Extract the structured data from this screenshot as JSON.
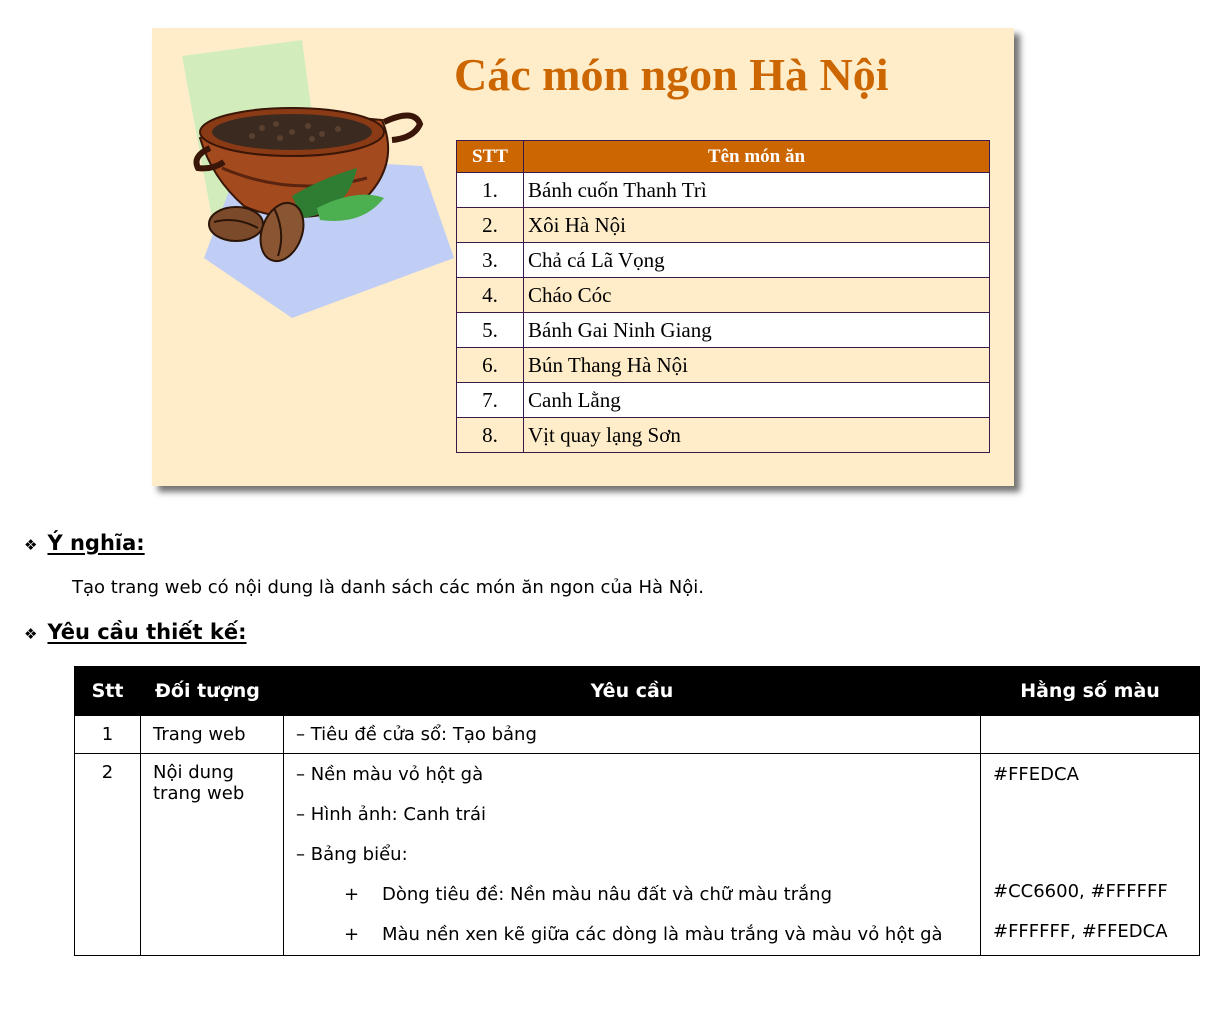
{
  "preview": {
    "title": "Các món ngon Hà Nội",
    "headers": [
      "STT",
      "Tên món ăn"
    ],
    "rows": [
      {
        "no": "1.",
        "name": "Bánh cuốn Thanh Trì"
      },
      {
        "no": "2.",
        "name": "Xôi Hà Nội"
      },
      {
        "no": "3.",
        "name": "Chả cá Lã Vọng"
      },
      {
        "no": "4.",
        "name": "Cháo Cóc"
      },
      {
        "no": "5.",
        "name": "Bánh Gai Ninh Giang"
      },
      {
        "no": "6.",
        "name": "Bún Thang Hà Nội"
      },
      {
        "no": "7.",
        "name": "Canh Lằng"
      },
      {
        "no": "8.",
        "name": "Vịt quay lạng Sơn"
      }
    ],
    "colors": {
      "background": "#FFEDCA",
      "header": "#CC6600",
      "title": "#CC6600"
    }
  },
  "meaning": {
    "bullet": "❖",
    "heading": "Ý nghĩa:",
    "text": "Tạo trang web có nội dung là danh sách các món ăn ngon của Hà Nội."
  },
  "design": {
    "bullet": "❖",
    "heading": "Yêu cầu thiết kế:",
    "columns": [
      "Stt",
      "Đối tượng",
      "Yêu cầu",
      "Hằng số màu"
    ],
    "rows": [
      {
        "stt": "1",
        "object": "Trang web",
        "req1": "– Tiêu đề cửa sổ: Tạo bảng",
        "color": ""
      },
      {
        "stt": "2",
        "object": "Nội dung trang web",
        "req1": "– Nền màu vỏ hột gà",
        "req2": "– Hình ảnh: Canh trái",
        "req3": "– Bảng biểu:",
        "plus": "+",
        "sub1": "Dòng tiêu đề: Nền màu nâu đất và chữ màu trắng",
        "sub2": "Màu nền xen kẽ giữa các dòng là màu trắng và màu vỏ hột gà",
        "color1": "#FFEDCA",
        "color2": "#CC6600, #FFFFFF",
        "color3": "#FFFFFF, #FFEDCA"
      }
    ]
  }
}
